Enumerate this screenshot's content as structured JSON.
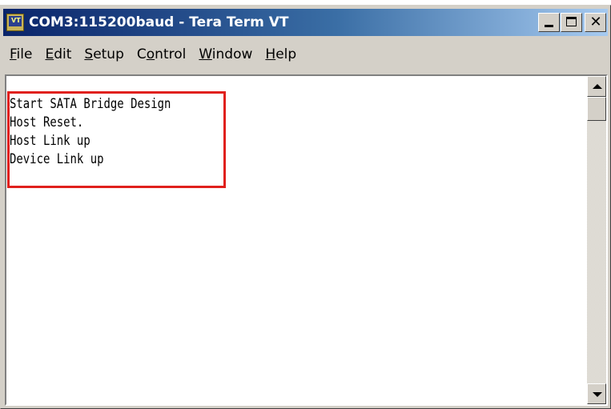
{
  "window": {
    "title": "COM3:115200baud - Tera Term VT",
    "icon": "tera-term-icon",
    "icon_label": "VT"
  },
  "menu": {
    "items": [
      {
        "key": "F",
        "rest": "ile"
      },
      {
        "key": "E",
        "rest": "dit"
      },
      {
        "key": "S",
        "rest": "etup"
      },
      {
        "pre": "C",
        "key": "o",
        "rest": "ntrol"
      },
      {
        "key": "W",
        "rest": "indow"
      },
      {
        "key": "H",
        "rest": "elp"
      }
    ]
  },
  "terminal": {
    "lines": [
      "Start SATA Bridge Design",
      "Host Reset.",
      "Host Link up",
      "Device Link up"
    ]
  },
  "colors": {
    "highlight": "#e0201c",
    "titlebar_start": "#0a246a",
    "titlebar_end": "#a6caf0",
    "chrome": "#d4d0c8"
  }
}
